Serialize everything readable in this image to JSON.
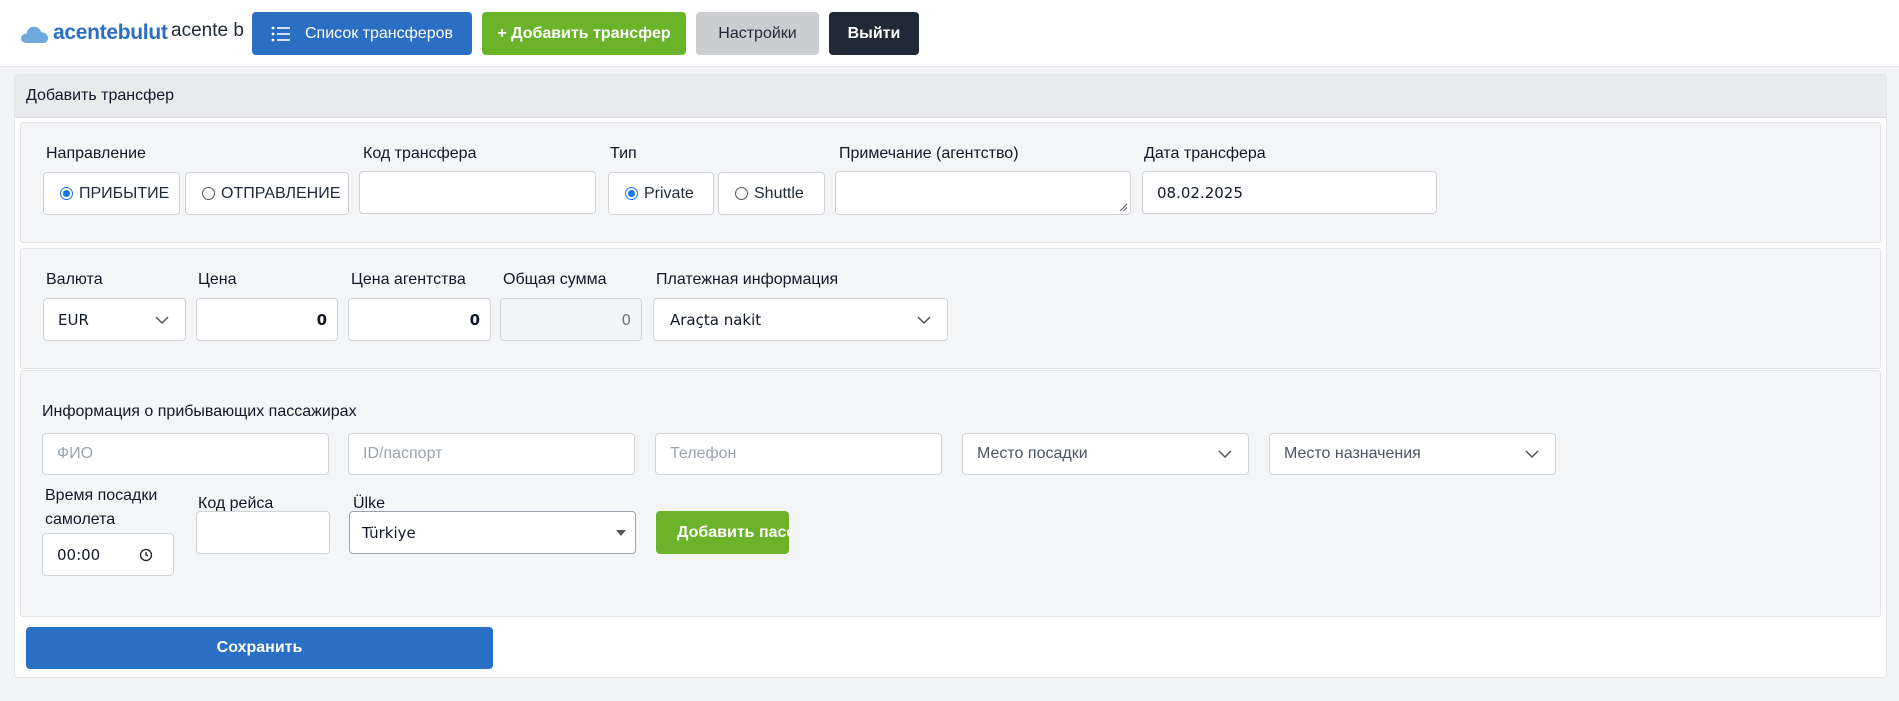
{
  "header": {
    "logo_text": "acentebulut",
    "agency_name": "acente b",
    "buttons": {
      "list": "Список трансферов",
      "add": "+ Добавить трансфер",
      "settings": "Настройки",
      "logout": "Выйти"
    }
  },
  "card": {
    "title": "Добавить трансфер"
  },
  "section1": {
    "direction_label": "Направление",
    "direction_options": [
      "ПРИБЫТИЕ",
      "ОТПРАВЛЕНИЕ"
    ],
    "direction_selected": "ПРИБЫТИЕ",
    "code_label": "Код трансфера",
    "code_value": "",
    "type_label": "Тип",
    "type_options": [
      "Private",
      "Shuttle"
    ],
    "type_selected": "Private",
    "note_label": "Примечание (агентство)",
    "note_value": "",
    "date_label": "Дата трансфера",
    "date_value": "08.02.2025"
  },
  "section2": {
    "currency_label": "Валюта",
    "currency_value": "EUR",
    "price_label": "Цена",
    "price_value": "0",
    "agency_price_label": "Цена агентства",
    "agency_price_value": "0",
    "total_label": "Общая сумма",
    "total_value": "0",
    "payment_label": "Платежная информация",
    "payment_value": "Araçta nakit"
  },
  "section3": {
    "title": "Информация о прибывающих пассажирах",
    "name_placeholder": "ФИО",
    "passport_placeholder": "ID/паспорт",
    "phone_placeholder": "Телефон",
    "pickup_placeholder": "Место посадки",
    "destination_placeholder": "Место назначения",
    "boarding_time_label": "Время посадки самолета",
    "boarding_time_value": "00:00",
    "flight_code_label": "Код рейса",
    "flight_code_value": "",
    "country_label": "Ülke",
    "country_value": "Türkiye",
    "add_passenger_label": "Добавить пассажира"
  },
  "footer": {
    "save_label": "Сохранить"
  },
  "colors": {
    "primary": "#2a6fc4",
    "success": "#6bb328",
    "dark": "#1f2937",
    "secondary": "#cbcdd0"
  }
}
